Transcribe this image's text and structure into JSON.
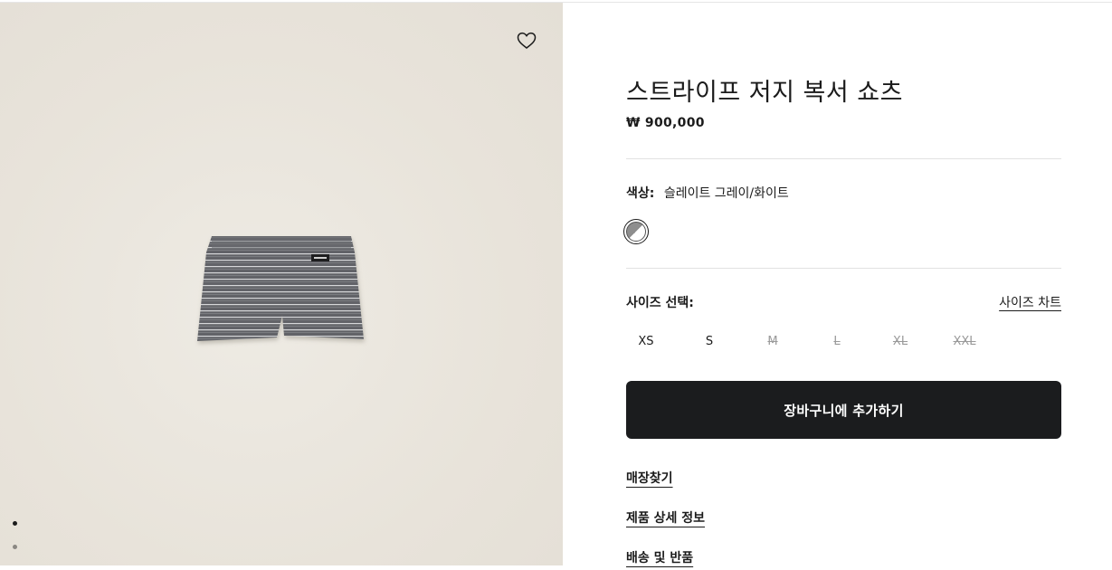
{
  "product": {
    "title": "스트라이프 저지 복서 쇼츠",
    "price": "₩ 900,000"
  },
  "gallery": {
    "image_alt": "striped jersey boxer shorts",
    "icons": {
      "favorite": "heart-outline-icon"
    },
    "dots": 3,
    "active_dot": 1
  },
  "color": {
    "label": "색상:",
    "value": "슬레이트 그레이/화이트",
    "swatch_colors": [
      "#8e8e8e",
      "#ffffff"
    ]
  },
  "size": {
    "label": "사이즈 선택:",
    "chart_link": "사이즈 차트",
    "options": [
      {
        "label": "XS",
        "available": true
      },
      {
        "label": "S",
        "available": true
      },
      {
        "label": "M",
        "available": false
      },
      {
        "label": "L",
        "available": false
      },
      {
        "label": "XL",
        "available": false
      },
      {
        "label": "XXL",
        "available": false
      }
    ]
  },
  "cart_button": "장바구니에 추가하기",
  "links": [
    "매장찾기",
    "제품 상세 정보",
    "배송 및 반품"
  ],
  "colors": {
    "button_bg": "#1b1c1e",
    "image_bg": "#e8e3da"
  }
}
